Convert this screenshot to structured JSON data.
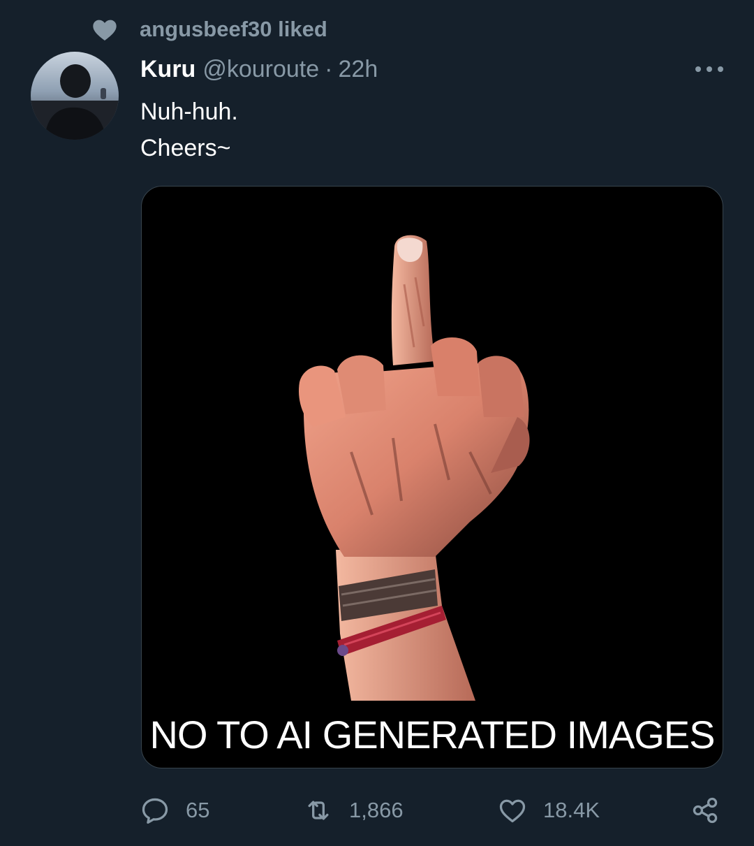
{
  "social_context": {
    "text": "angusbeef30 liked",
    "icon": "heart-filled-icon"
  },
  "author": {
    "display_name": "Kuru",
    "handle": "@kouroute",
    "separator": "·",
    "timestamp": "22h",
    "avatar": "profile-photo"
  },
  "tweet": {
    "lines": [
      "Nuh-huh.",
      "Cheers~"
    ]
  },
  "media": {
    "caption": "NO TO AI GENERATED IMAGES",
    "subject": "illustrated-hand-middle-finger"
  },
  "actions": {
    "reply": {
      "icon": "reply-icon",
      "count": "65"
    },
    "retweet": {
      "icon": "retweet-icon",
      "count": "1,866"
    },
    "like": {
      "icon": "heart-outline-icon",
      "count": "18.4K"
    },
    "share": {
      "icon": "share-icon"
    }
  },
  "colors": {
    "background": "#15202b",
    "secondary_text": "#8899a6",
    "primary_text": "#ffffff",
    "media_border": "#38444d"
  }
}
